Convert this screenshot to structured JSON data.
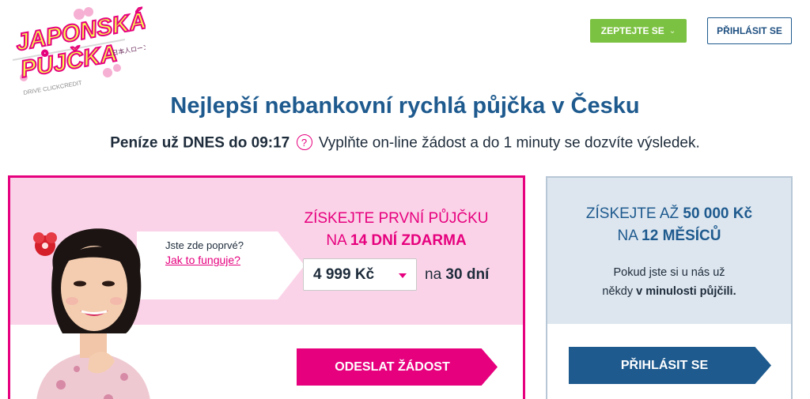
{
  "header": {
    "logo": {
      "line1": "JAPONSKÁ",
      "line2": "PŮJČKA",
      "japanese": "日本人ローン",
      "tagline": "DRIVE CLICKCREDIT"
    },
    "ask_button": "ZEPTEJTE SE",
    "login_button": "PŘIHLÁSIT SE"
  },
  "hero": {
    "headline": "Nejlepší nebankovní rychlá půjčka v Česku",
    "sub_bold": "Peníze už DNES do 09:17",
    "help_icon_glyph": "?",
    "sub_text": "Vyplňte on-line žádost a do 1 minuty se dozvíte výsledek."
  },
  "first_loan": {
    "title_line1": "ZÍSKEJTE PRVNÍ PŮJČKU",
    "title_line2_pre": "NA ",
    "title_line2_bold": "14 DNÍ ZDARMA",
    "bubble_question": "Jste zde poprvé?",
    "bubble_link": "Jak to funguje?",
    "amount_value": "4 999 Kč",
    "period_pre": "na ",
    "period_bold": "30 dní",
    "submit_button": "ODESLAT ŽÁDOST"
  },
  "returning": {
    "title_line1_pre": "ZÍSKEJTE AŽ ",
    "title_line1_bold": "50 000 Kč",
    "title_line2_pre": "NA ",
    "title_line2_bold": "12 MĚSÍCŮ",
    "desc_line1": "Pokud jste si u nás už",
    "desc_line2_pre": "někdy ",
    "desc_line2_bold": "v minulosti půjčili.",
    "login_button": "PŘIHLÁSIT SE"
  },
  "colors": {
    "brand_pink": "#e6007e",
    "brand_blue": "#1e5a8e",
    "ask_green": "#7cc242",
    "pink_panel": "#fbd3e8",
    "blue_panel": "#dde6ef"
  }
}
